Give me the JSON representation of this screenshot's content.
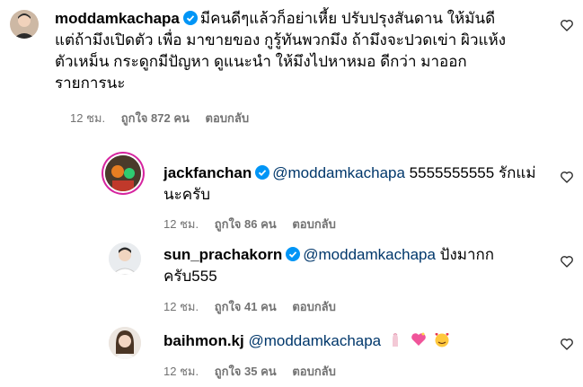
{
  "comments": [
    {
      "username": "moddamkachapa",
      "verified": true,
      "text_lines": [
        "มีคนดีๆแล้วก็อย่าเหี้ย ปรับปรุงสันดาน ให้มันดี",
        "แต่ถ้ามึงเปิดตัว เพื่อ มาขายของ กูรู้ทันพวกมึง ถ้ามึงจะปวดเข่า ผิวแห้ง",
        "ตัวเหม็น กระดูกมีปัญหา ดูแนะนำ ให้มึงไปหาหมอ ดีกว่า มาออก",
        "รายการนะ"
      ],
      "time": "12 ชม.",
      "likes": "ถูกใจ 872 คน",
      "reply": "ตอบกลับ"
    },
    {
      "username": "jackfanchan",
      "verified": true,
      "mention": "@moddamkachapa",
      "text_after": "5555555555 รักแม่",
      "text_line2": "นะครับ",
      "time": "12 ชม.",
      "likes": "ถูกใจ 86 คน",
      "reply": "ตอบกลับ"
    },
    {
      "username": "sun_prachakorn",
      "verified": true,
      "mention": "@moddamkachapa",
      "text_after": "ปังมากก",
      "text_line2": "ครับ555",
      "time": "12 ชม.",
      "likes": "ถูกใจ 41 คน",
      "reply": "ตอบกลับ"
    },
    {
      "username": "baihmon.kj",
      "verified": false,
      "mention": "@moddamkachapa",
      "emojis": [
        "pinched-fingers-icon",
        "sparkling-heart-icon",
        "smiling-face-with-hearts-icon"
      ],
      "time": "12 ชม.",
      "likes": "ถูกใจ 35 คน",
      "reply": "ตอบกลับ"
    }
  ],
  "colors": {
    "meta": "#737373",
    "mention": "#00376b",
    "verified": "#0095f6"
  }
}
